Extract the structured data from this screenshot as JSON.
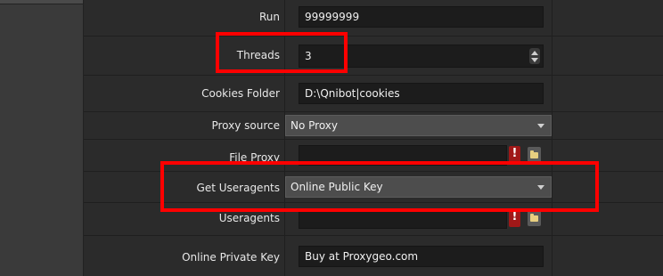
{
  "properties": {
    "run": {
      "label": "Run",
      "value": "99999999"
    },
    "threads": {
      "label": "Threads",
      "value": "3"
    },
    "cookies_folder": {
      "label": "Cookies Folder",
      "value": "D:\\Qnibot|cookies"
    },
    "proxy_source": {
      "label": "Proxy source",
      "value": "No Proxy"
    },
    "file_proxy": {
      "label": "File Proxy",
      "value": ""
    },
    "get_useragents": {
      "label": "Get Useragents",
      "value": "Online Public Key"
    },
    "useragents": {
      "label": "Useragents",
      "value": ""
    },
    "online_private_key": {
      "label": "Online Private Key",
      "value": "Buy at Proxygeo.com"
    }
  },
  "icons": {
    "warning": "exclamation-icon",
    "folder": "folder-icon"
  },
  "colors": {
    "highlight": "#ff0000",
    "warning": "#a01818"
  }
}
